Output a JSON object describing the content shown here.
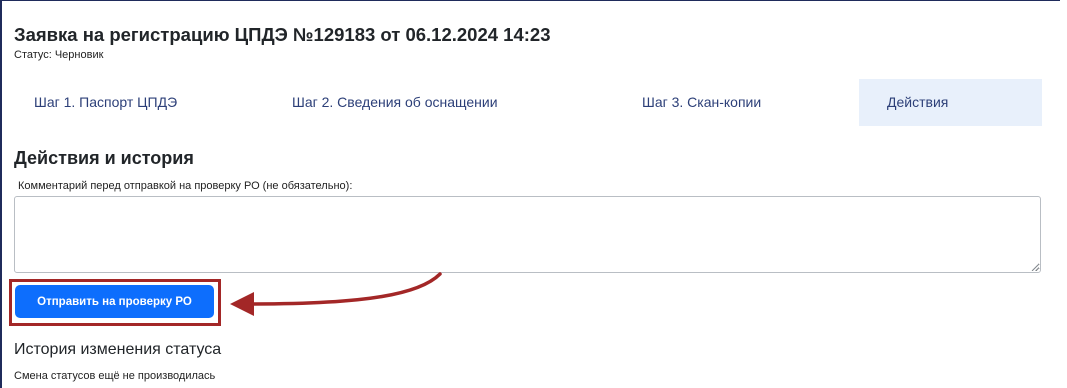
{
  "header": {
    "title": "Заявка на регистрацию ЦПДЭ №129183 от 06.12.2024 14:23",
    "status_label": "Статус:",
    "status_value": "Черновик"
  },
  "tabs": [
    {
      "label": "Шаг 1. Паспорт ЦПДЭ",
      "active": false
    },
    {
      "label": "Шаг 2. Сведения об оснащении",
      "active": false
    },
    {
      "label": "Шаг 3. Скан-копии",
      "active": false
    },
    {
      "label": "Действия",
      "active": true
    }
  ],
  "actions": {
    "title": "Действия и история",
    "comment_label": "Комментарий перед отправкой на проверку РО (не обязательно):",
    "comment_value": "",
    "submit_label": "Отправить на проверку РО"
  },
  "history": {
    "title": "История изменения статуса",
    "empty_text": "Смена статусов ещё не производилась"
  },
  "colors": {
    "primary_button": "#0d6efd",
    "annotation": "#a32727",
    "active_tab_bg": "#e8f0fb",
    "tab_text": "#2c3f78"
  }
}
